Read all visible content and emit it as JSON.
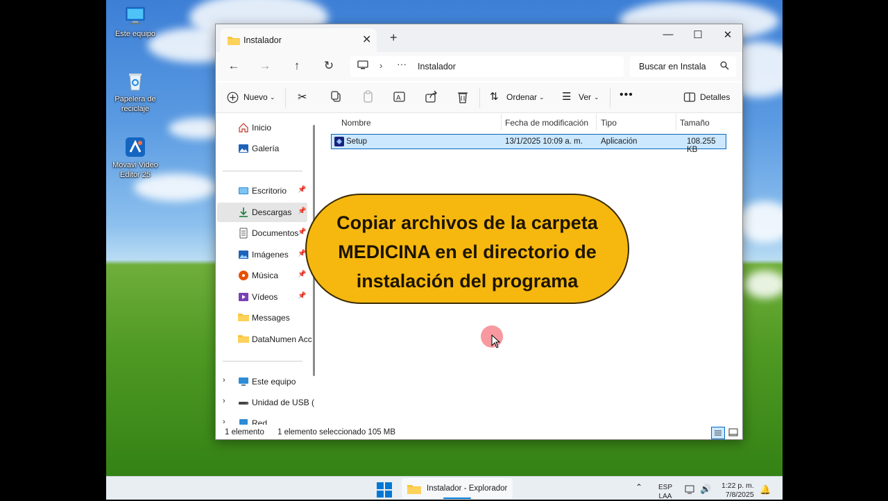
{
  "desktop": {
    "icons": [
      {
        "label": "Este equipo"
      },
      {
        "label": "Papelera de reciclaje"
      },
      {
        "label": "Movavi Video Editor 25"
      }
    ]
  },
  "window": {
    "tab_title": "Instalador",
    "address_crumb": "Instalador",
    "search_placeholder": "Buscar en Instala"
  },
  "toolbar": {
    "new_label": "Nuevo",
    "sort_label": "Ordenar",
    "view_label": "Ver",
    "details_label": "Detalles"
  },
  "sidebar": {
    "items": [
      {
        "label": "Inicio"
      },
      {
        "label": "Galería"
      },
      {
        "label": "Escritorio"
      },
      {
        "label": "Descargas"
      },
      {
        "label": "Documentos"
      },
      {
        "label": "Imágenes"
      },
      {
        "label": "Música"
      },
      {
        "label": "Vídeos"
      },
      {
        "label": "Messages"
      },
      {
        "label": "DataNumen Acc"
      },
      {
        "label": "Este equipo"
      },
      {
        "label": "Unidad de USB ("
      },
      {
        "label": "Red"
      }
    ]
  },
  "columns": {
    "name": "Nombre",
    "modified": "Fecha de modificación",
    "type": "Tipo",
    "size": "Tamaño"
  },
  "files": [
    {
      "name": "Setup",
      "modified": "13/1/2025 10:09 a. m.",
      "type": "Aplicación",
      "size": "108.255 KB"
    }
  ],
  "status": {
    "count": "1 elemento",
    "selection": "1 elemento seleccionado  105 MB"
  },
  "callout": {
    "line1": "Copiar archivos de la carpeta",
    "line2": "MEDICINA en el directorio de",
    "line3": "instalación del programa"
  },
  "taskbar": {
    "app_label": "Instalador - Explorador",
    "lang_top": "ESP",
    "lang_bottom": "LAA",
    "time": "1:22 p. m.",
    "date": "7/8/2025"
  }
}
